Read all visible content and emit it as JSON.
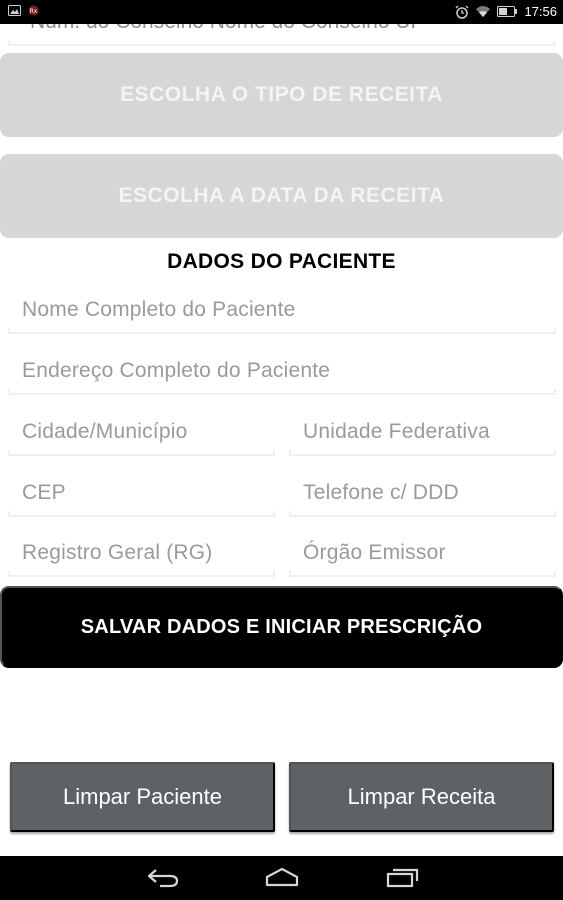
{
  "status_bar": {
    "time": "17:56",
    "left_icons": [
      "gallery-icon",
      "app-badge-icon"
    ],
    "right_icons": [
      "alarm-icon",
      "wifi-icon",
      "battery-icon"
    ]
  },
  "form": {
    "clipped_field_text": "Num. do Conselho   Nome do Conselho   UF",
    "prescription_type_button": "ESCOLHA O TIPO DE RECEITA",
    "prescription_date_button": "ESCOLHA A DATA DA RECEITA",
    "patient_section_title": "DADOS DO PACIENTE",
    "fields": {
      "full_name": "Nome Completo do Paciente",
      "address": "Endereço Completo do Paciente",
      "city": "Cidade/Município",
      "state": "Unidade Federativa",
      "zip": "CEP",
      "phone": "Telefone c/ DDD",
      "rg": "Registro Geral (RG)",
      "issuer": "Órgão Emissor"
    },
    "save_button": "SALVAR DADOS E INICIAR PRESCRIÇÃO"
  },
  "actions": {
    "clear_patient": "Limpar Paciente",
    "clear_prescription": "Limpar Receita"
  },
  "nav": {
    "icons": [
      "back-icon",
      "home-icon",
      "recent-apps-icon"
    ]
  },
  "colors": {
    "disabled_button": "#d6d6d6",
    "primary_button": "#000000",
    "secondary_button": "#5f6265",
    "field_underline": "#e5f3f8",
    "hint_text": "#9a9a9a"
  }
}
